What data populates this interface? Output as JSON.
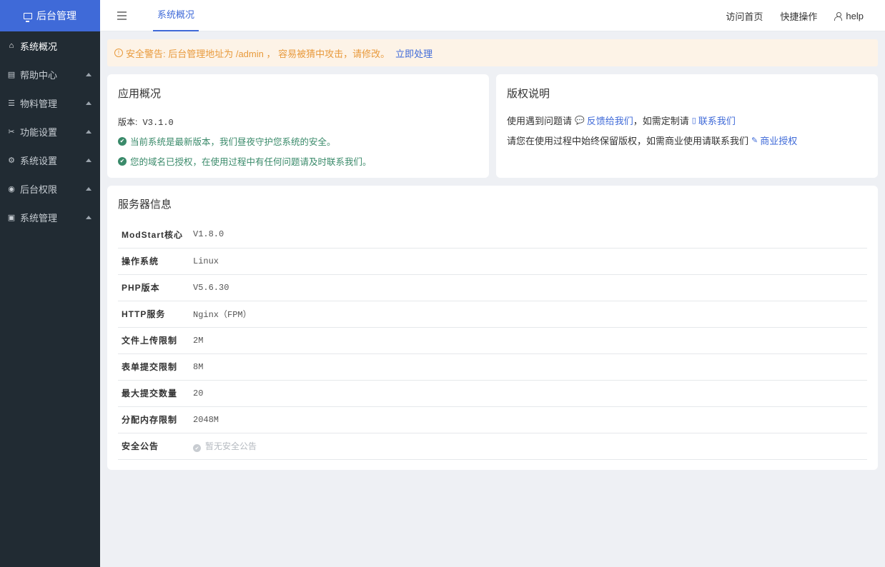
{
  "sidebar": {
    "brand": "后台管理",
    "items": [
      {
        "label": "系统概况",
        "icon": "home-icon",
        "active": true
      },
      {
        "label": "帮助中心",
        "icon": "book-icon"
      },
      {
        "label": "物料管理",
        "icon": "list-icon"
      },
      {
        "label": "功能设置",
        "icon": "tools-icon"
      },
      {
        "label": "系统设置",
        "icon": "gear-icon"
      },
      {
        "label": "后台权限",
        "icon": "user-circle-icon"
      },
      {
        "label": "系统管理",
        "icon": "chart-icon"
      }
    ]
  },
  "header": {
    "tab": "系统概况",
    "links": [
      "访问首页",
      "快捷操作"
    ],
    "user": "help"
  },
  "alert": {
    "text": "安全警告: 后台管理地址为 /admin ， 容易被猜中攻击，请修改。",
    "action": "立即处理"
  },
  "app_overview": {
    "title": "应用概况",
    "version_label": "版本:",
    "version": "V3.1.0",
    "msg1": "当前系统是最新版本，我们昼夜守护您系统的安全。",
    "msg2": "您的域名已授权，在使用过程中有任何问题请及时联系我们。"
  },
  "copyright": {
    "title": "版权说明",
    "line1_pre": "使用遇到问题请",
    "line1_link1": "反馈给我们",
    "line1_mid": "，如需定制请",
    "line1_link2": "联系我们",
    "line2_pre": "请您在使用过程中始终保留版权，如需商业使用请联系我们",
    "line2_link": "商业授权"
  },
  "server": {
    "title": "服务器信息",
    "rows": [
      {
        "k": "ModStart核心",
        "v": "V1.8.0"
      },
      {
        "k": "操作系统",
        "v": "Linux"
      },
      {
        "k": "PHP版本",
        "v": "V5.6.30"
      },
      {
        "k": "HTTP服务",
        "v": "Nginx（FPM）"
      },
      {
        "k": "文件上传限制",
        "v": "2M"
      },
      {
        "k": "表单提交限制",
        "v": "8M"
      },
      {
        "k": "最大提交数量",
        "v": "20"
      },
      {
        "k": "分配内存限制",
        "v": "2048M"
      },
      {
        "k": "安全公告",
        "v": "暂无安全公告"
      }
    ]
  },
  "colors": {
    "accent": "#3f6ad8",
    "sidebar": "#212b33",
    "success": "#3a8a6a",
    "warning": "#e89a3c"
  }
}
